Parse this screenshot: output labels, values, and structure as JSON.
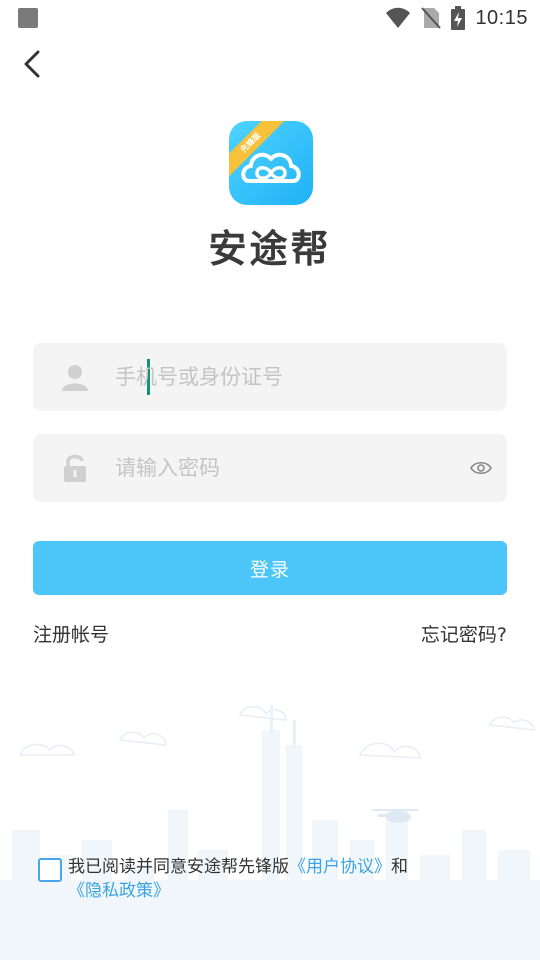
{
  "status_bar": {
    "time": "10:15"
  },
  "app": {
    "name": "安途帮",
    "badge": "先锋版"
  },
  "login_form": {
    "account_placeholder": "手机号或身份证号",
    "password_placeholder": "请输入密码",
    "login_label": "登录",
    "register_label": "注册帐号",
    "forgot_label": "忘记密码?"
  },
  "agreement": {
    "prefix": "我已阅读并同意安途帮先锋版",
    "user_agreement": "《用户协议》",
    "and": "和",
    "privacy_policy": "《隐私政策》"
  },
  "colors": {
    "accent": "#4cc6f8",
    "link": "#3aa3e6",
    "logo_badge": "#f7c23a"
  },
  "icons": [
    "back-icon",
    "wifi-icon",
    "no-sim-icon",
    "battery-charging-icon",
    "user-icon",
    "lock-icon",
    "eye-icon"
  ]
}
